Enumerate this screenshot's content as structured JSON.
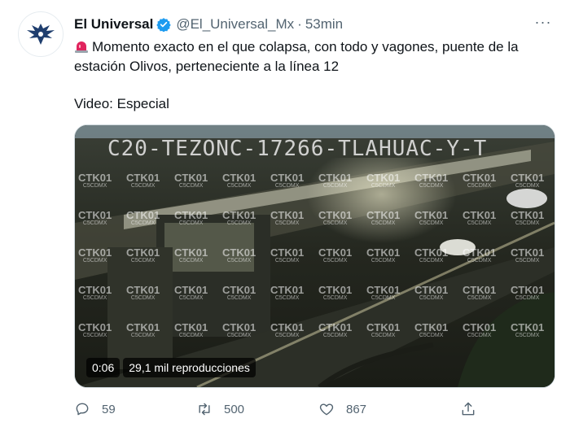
{
  "tweet": {
    "author_name": "El Universal",
    "handle": "@El_Universal_Mx",
    "separator": "·",
    "time": "53min",
    "text_line1": "Momento exacto en el que colapsa, con todo y vagones, puente de la",
    "text_line2": "estación Olivos, perteneciente a la línea 12",
    "video_label": "Video: Especial",
    "more_label": "···"
  },
  "media": {
    "camera_text": "C20-TEZONC-17266-TLAHUAC-Y-T",
    "watermark_top": "CTK01",
    "watermark_bottom": "C5CDMX",
    "duration": "0:06",
    "views": "29,1 mil reproducciones"
  },
  "actions": {
    "replies": "59",
    "retweets": "500",
    "likes": "867"
  },
  "icons": {
    "verified": "verified-badge-icon",
    "siren": "police-siren-emoji-icon",
    "reply": "reply-icon",
    "retweet": "retweet-icon",
    "like": "heart-icon",
    "share": "share-icon"
  },
  "colors": {
    "verified": "#1d9bf0",
    "text_secondary": "#536471",
    "text_primary": "#0f1419"
  }
}
